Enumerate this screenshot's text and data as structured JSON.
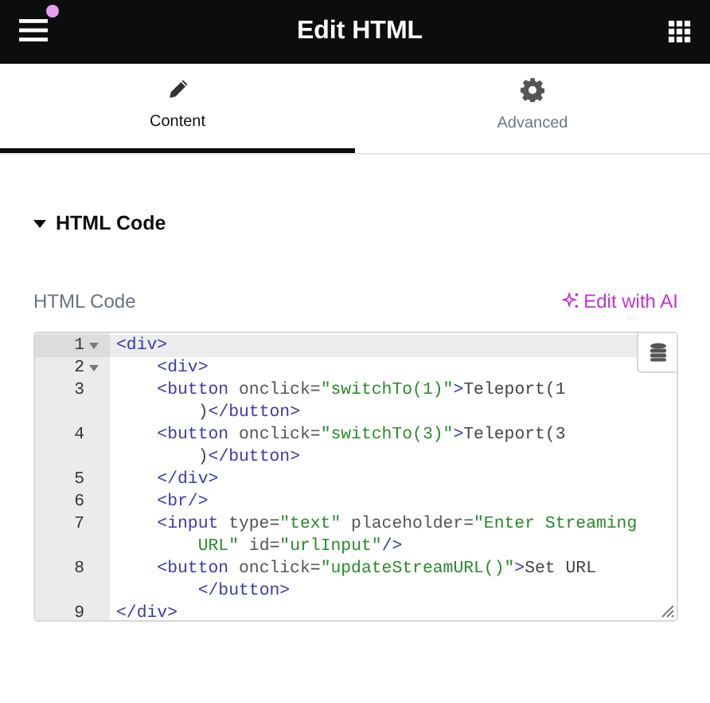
{
  "header": {
    "title": "Edit HTML",
    "menu_notification": true
  },
  "tabs": [
    {
      "label": "Content",
      "selected": true
    },
    {
      "label": "Advanced",
      "selected": false
    }
  ],
  "section": {
    "title": "HTML Code",
    "expanded": true
  },
  "field": {
    "label": "HTML Code",
    "ai_link": "Edit with AI"
  },
  "editor": {
    "lines": [
      {
        "number": "1",
        "foldable": true,
        "current": true,
        "indented": false,
        "rows": [
          [
            {
              "kind": "tag",
              "text": "<div>"
            }
          ]
        ]
      },
      {
        "number": "2",
        "foldable": true,
        "current": false,
        "indented": true,
        "rows": [
          [
            {
              "kind": "tag",
              "text": "<div>"
            }
          ]
        ]
      },
      {
        "number": "3",
        "foldable": false,
        "current": false,
        "indented": true,
        "rows": [
          [
            {
              "kind": "tag",
              "text": "<button"
            },
            {
              "kind": "attr",
              "text": " onclick="
            },
            {
              "kind": "string",
              "text": "\"switchTo(1)\""
            },
            {
              "kind": "tag",
              "text": ">"
            },
            {
              "kind": "text",
              "text": "Teleport(1"
            }
          ],
          [
            {
              "kind": "text",
              "text": ")"
            },
            {
              "kind": "tag",
              "text": "</button>"
            }
          ]
        ]
      },
      {
        "number": "4",
        "foldable": false,
        "current": false,
        "indented": true,
        "rows": [
          [
            {
              "kind": "tag",
              "text": "<button"
            },
            {
              "kind": "attr",
              "text": " onclick="
            },
            {
              "kind": "string",
              "text": "\"switchTo(3)\""
            },
            {
              "kind": "tag",
              "text": ">"
            },
            {
              "kind": "text",
              "text": "Teleport(3"
            }
          ],
          [
            {
              "kind": "text",
              "text": ")"
            },
            {
              "kind": "tag",
              "text": "</button>"
            }
          ]
        ]
      },
      {
        "number": "5",
        "foldable": false,
        "current": false,
        "indented": true,
        "rows": [
          [
            {
              "kind": "tag",
              "text": "</div>"
            }
          ]
        ]
      },
      {
        "number": "6",
        "foldable": false,
        "current": false,
        "indented": true,
        "rows": [
          [
            {
              "kind": "tag",
              "text": "<br/>"
            }
          ]
        ]
      },
      {
        "number": "7",
        "foldable": false,
        "current": false,
        "indented": true,
        "rows": [
          [
            {
              "kind": "tag",
              "text": "<input"
            },
            {
              "kind": "attr",
              "text": " type="
            },
            {
              "kind": "string",
              "text": "\"text\""
            },
            {
              "kind": "attr",
              "text": " placeholder="
            },
            {
              "kind": "string",
              "text": "\"Enter Streaming"
            }
          ],
          [
            {
              "kind": "string",
              "text": "URL\""
            },
            {
              "kind": "attr",
              "text": " id="
            },
            {
              "kind": "string",
              "text": "\"urlInput\""
            },
            {
              "kind": "tag",
              "text": "/>"
            }
          ]
        ]
      },
      {
        "number": "8",
        "foldable": false,
        "current": false,
        "indented": true,
        "rows": [
          [
            {
              "kind": "tag",
              "text": "<button"
            },
            {
              "kind": "attr",
              "text": " onclick="
            },
            {
              "kind": "string",
              "text": "\"updateStreamURL()\""
            },
            {
              "kind": "tag",
              "text": ">"
            },
            {
              "kind": "text",
              "text": "Set URL"
            }
          ],
          [
            {
              "kind": "tag",
              "text": "</button>"
            }
          ]
        ]
      },
      {
        "number": "9",
        "foldable": false,
        "current": false,
        "indented": false,
        "rows": [
          [
            {
              "kind": "tag",
              "text": "</div>"
            }
          ]
        ]
      }
    ]
  }
}
